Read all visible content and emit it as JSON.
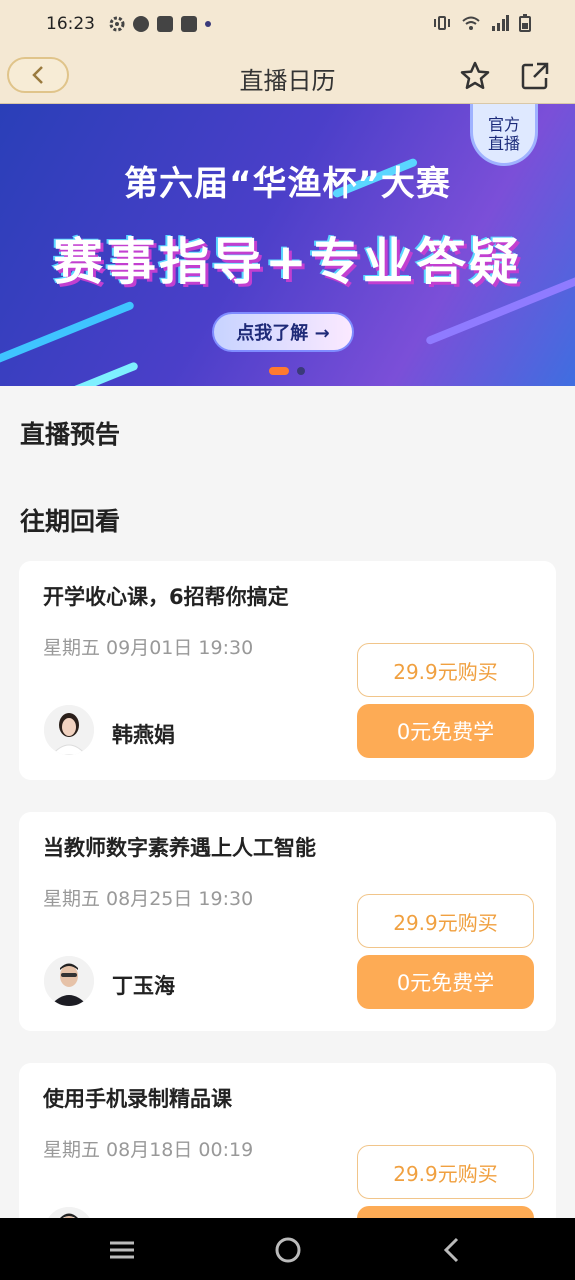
{
  "status_bar": {
    "time": "16:23",
    "left_icons": [
      "gear-icon",
      "app-icon",
      "bag-icon",
      "bag-icon",
      "dot-icon"
    ],
    "right_icons": [
      "vibrate-icon",
      "wifi-icon",
      "signal-icon",
      "battery-icon"
    ]
  },
  "header": {
    "title": "直播日历",
    "icons": [
      "back-icon",
      "star-icon",
      "share-icon"
    ]
  },
  "banner": {
    "badge_line1": "官方",
    "badge_line2": "直播",
    "line1": "第六届“华渔杯”大赛",
    "line2": "赛事指导+专业答疑",
    "button_label": "点我了解 →",
    "active_slide": 1,
    "slide_count": 2
  },
  "sections": {
    "upcoming": "直播预告",
    "replay": "往期回看"
  },
  "courses": [
    {
      "title": "开学收心课，6招帮你搞定",
      "time": "星期五 09月01日 19:30",
      "teacher": "韩燕娟",
      "buy_label": "29.9元购买",
      "free_label": "0元免费学"
    },
    {
      "title": "当教师数字素养遇上人工智能",
      "time": "星期五 08月25日 19:30",
      "teacher": "丁玉海",
      "buy_label": "29.9元购买",
      "free_label": "0元免费学"
    },
    {
      "title": "使用手机录制精品课",
      "time": "星期五 08月18日 00:19",
      "teacher": "",
      "buy_label": "29.9元购买",
      "free_label": ""
    }
  ],
  "colors": {
    "header_bg": "#f4e8d3",
    "accent": "#fdab55",
    "buy_text": "#f0a040",
    "indicator_active": "#ff7a2f"
  },
  "nav_bar": {
    "icons": [
      "menu-icon",
      "home-icon",
      "back-nav-icon"
    ]
  }
}
